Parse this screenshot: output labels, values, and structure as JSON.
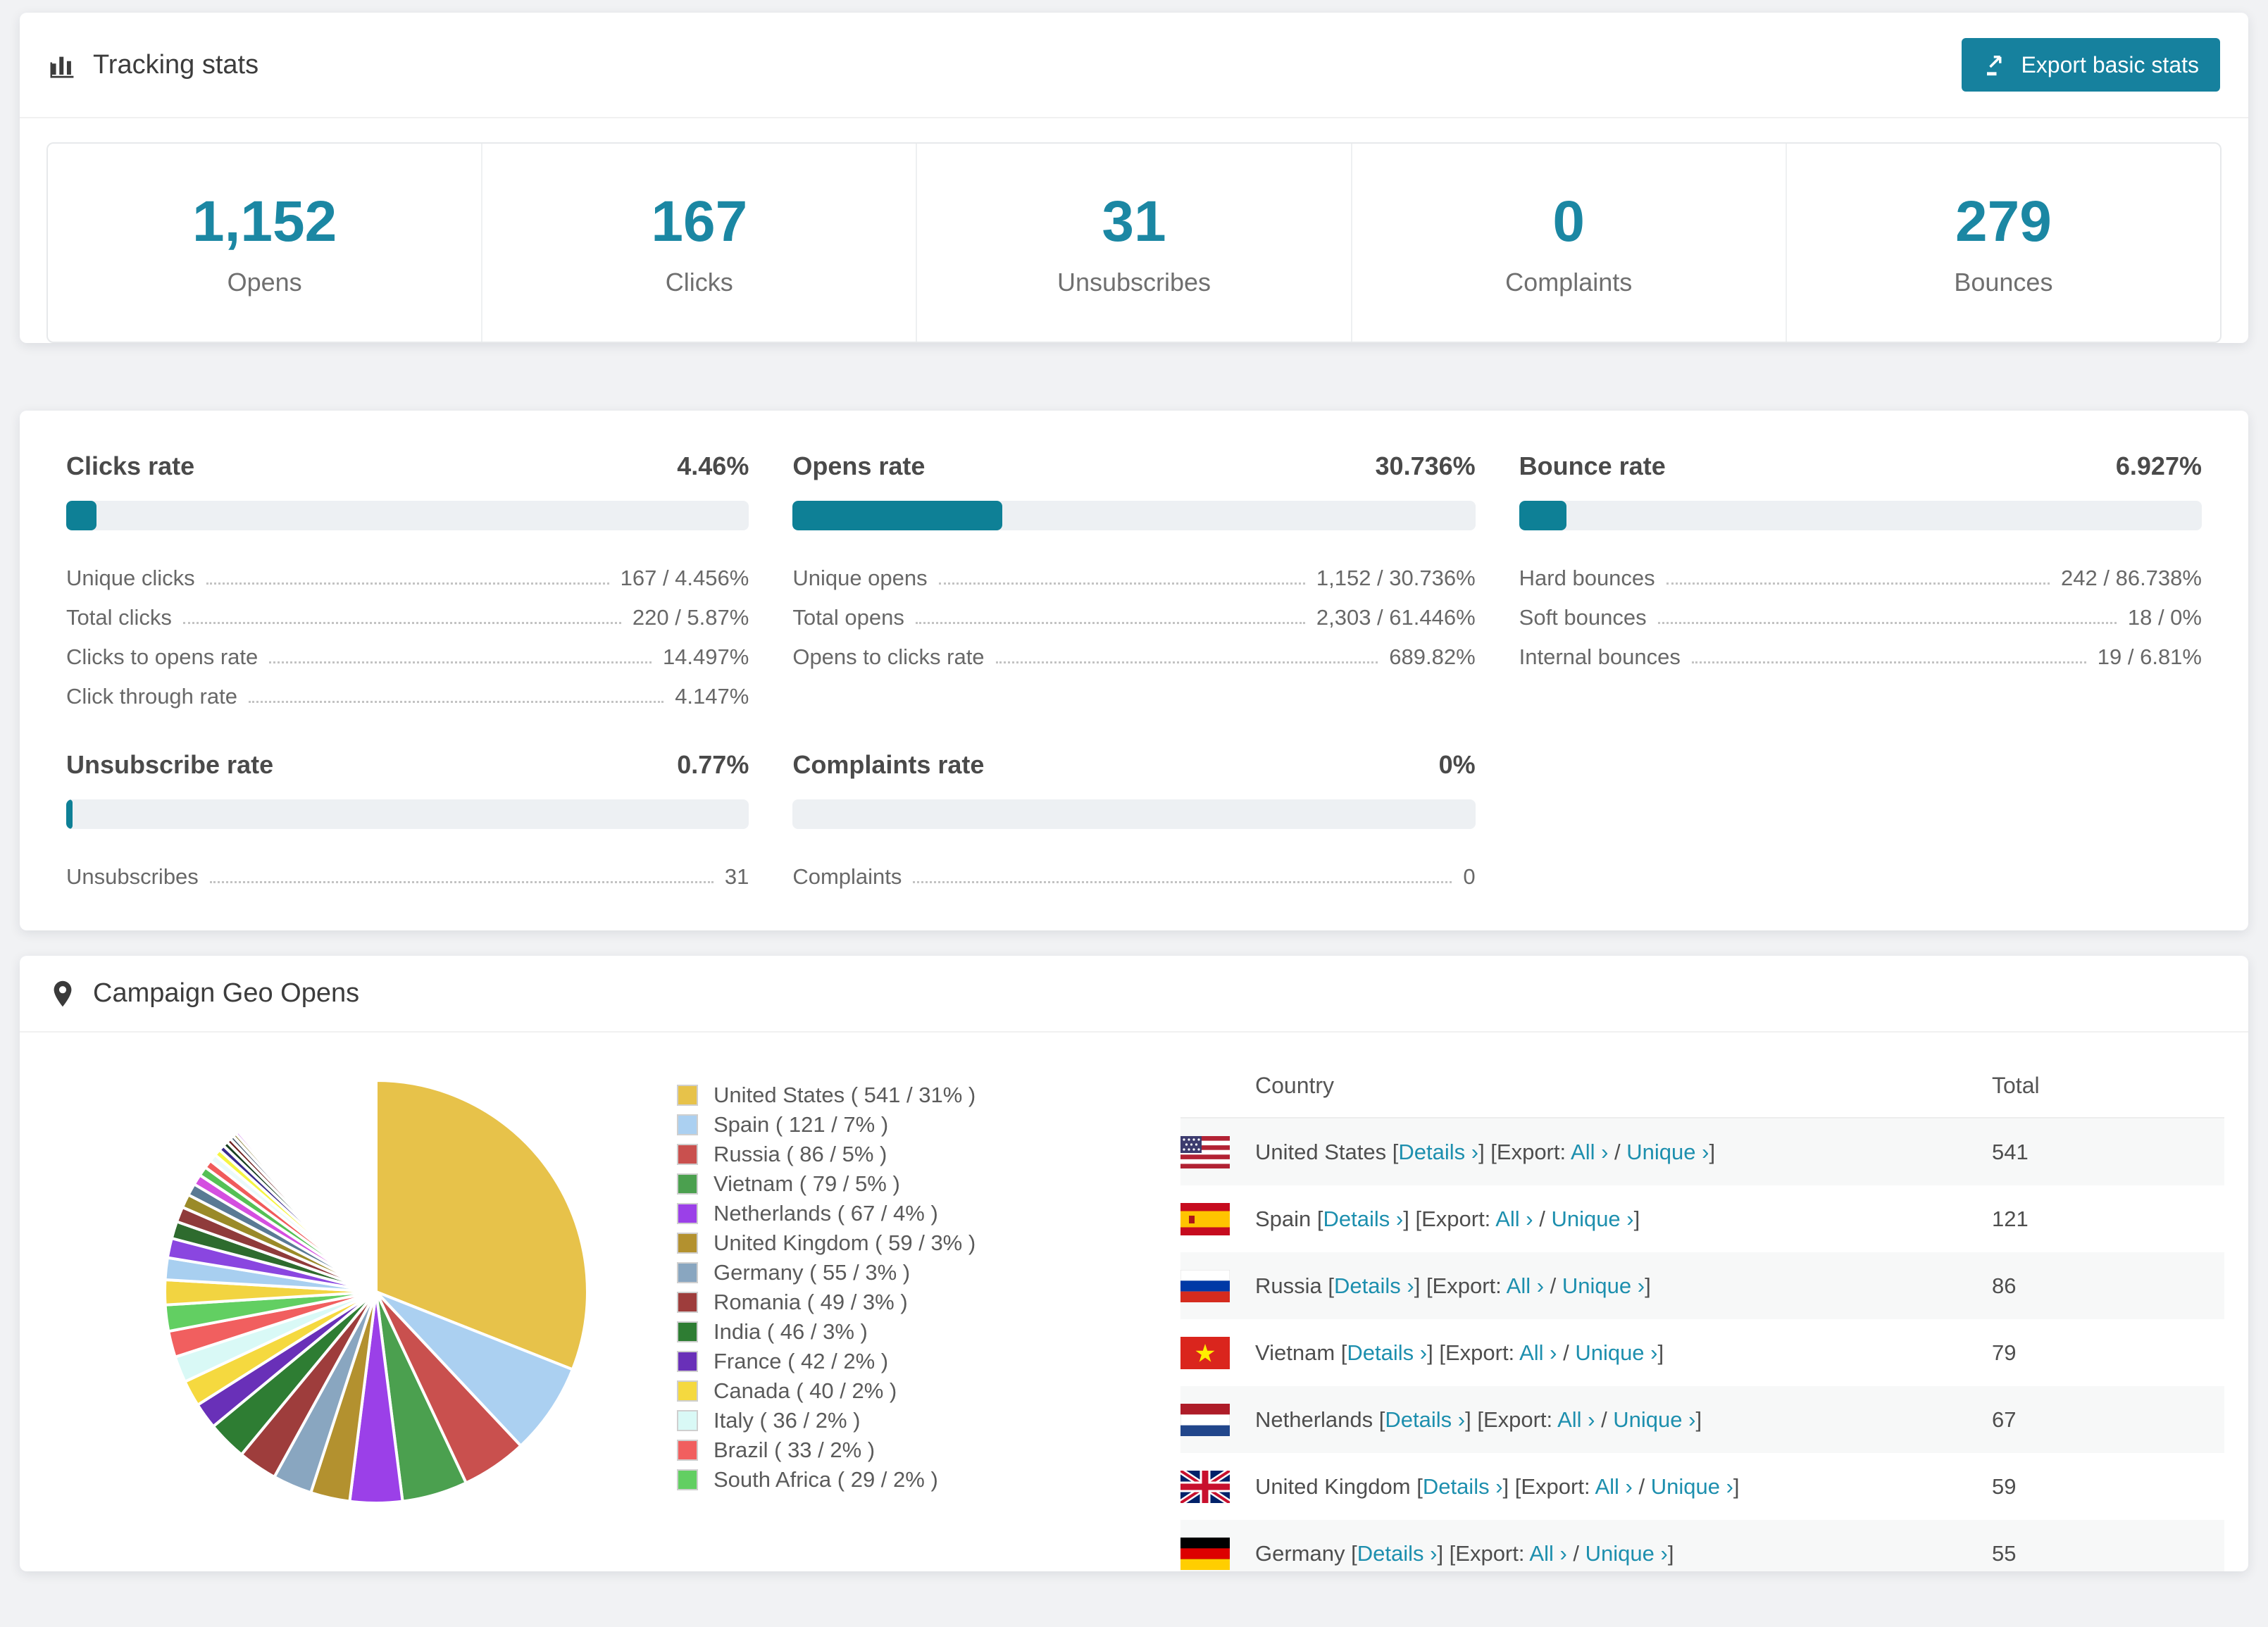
{
  "accent": "#16819e",
  "tracking": {
    "title": "Tracking stats",
    "export_button": "Export basic stats",
    "summary": [
      {
        "value": "1,152",
        "label": "Opens"
      },
      {
        "value": "167",
        "label": "Clicks"
      },
      {
        "value": "31",
        "label": "Unsubscribes"
      },
      {
        "value": "0",
        "label": "Complaints"
      },
      {
        "value": "279",
        "label": "Bounces"
      }
    ]
  },
  "rates": {
    "sections": [
      {
        "title": "Clicks rate",
        "value": "4.46%",
        "bar_pct": 4.46,
        "rows": [
          {
            "label": "Unique clicks",
            "value": "167 / 4.456%"
          },
          {
            "label": "Total clicks",
            "value": "220 / 5.87%"
          },
          {
            "label": "Clicks to opens rate",
            "value": "14.497%"
          },
          {
            "label": "Click through rate",
            "value": "4.147%"
          }
        ]
      },
      {
        "title": "Opens rate",
        "value": "30.736%",
        "bar_pct": 30.736,
        "rows": [
          {
            "label": "Unique opens",
            "value": "1,152 / 30.736%"
          },
          {
            "label": "Total opens",
            "value": "2,303 / 61.446%"
          },
          {
            "label": "Opens to clicks rate",
            "value": "689.82%"
          }
        ]
      },
      {
        "title": "Bounce rate",
        "value": "6.927%",
        "bar_pct": 6.927,
        "rows": [
          {
            "label": "Hard bounces",
            "value": "242 / 86.738%"
          },
          {
            "label": "Soft bounces",
            "value": "18 / 0%"
          },
          {
            "label": "Internal bounces",
            "value": "19 / 6.81%"
          }
        ]
      },
      {
        "title": "Unsubscribe rate",
        "value": "0.77%",
        "bar_pct": 0.77,
        "rows": [
          {
            "label": "Unsubscribes",
            "value": "31"
          }
        ]
      },
      {
        "title": "Complaints rate",
        "value": "0%",
        "bar_pct": 0,
        "rows": [
          {
            "label": "Complaints",
            "value": "0"
          }
        ]
      }
    ]
  },
  "geo": {
    "title": "Campaign Geo Opens",
    "legend": [
      {
        "name": "United States",
        "count": "541",
        "pct": 31,
        "color": "#e7c24a"
      },
      {
        "name": "Spain",
        "count": "121",
        "pct": 7,
        "color": "#abd0f1"
      },
      {
        "name": "Russia",
        "count": "86",
        "pct": 5,
        "color": "#c9504e"
      },
      {
        "name": "Vietnam",
        "count": "79",
        "pct": 5,
        "color": "#4ba04f"
      },
      {
        "name": "Netherlands",
        "count": "67",
        "pct": 4,
        "color": "#9b40e8"
      },
      {
        "name": "United Kingdom",
        "count": "59",
        "pct": 3,
        "color": "#b3912f"
      },
      {
        "name": "Germany",
        "count": "55",
        "pct": 3,
        "color": "#89a6c0"
      },
      {
        "name": "Romania",
        "count": "49",
        "pct": 3,
        "color": "#9e3d3c"
      },
      {
        "name": "India",
        "count": "46",
        "pct": 3,
        "color": "#2e7d33"
      },
      {
        "name": "France",
        "count": "42",
        "pct": 2,
        "color": "#6930b8"
      },
      {
        "name": "Canada",
        "count": "40",
        "pct": 2,
        "color": "#f5d93f"
      },
      {
        "name": "Italy",
        "count": "36",
        "pct": 2,
        "color": "#d9f9f6"
      },
      {
        "name": "Brazil",
        "count": "33",
        "pct": 2,
        "color": "#f15f5f"
      },
      {
        "name": "South Africa",
        "count": "29",
        "pct": 2,
        "color": "#62cf62"
      }
    ],
    "pie_extra_colors": [
      "#f2d441",
      "#a8cff0",
      "#8a46e0",
      "#2e6b2e",
      "#8f3b3b",
      "#9a8a28",
      "#5a7a94",
      "#d44fe0",
      "#55c055",
      "#f05b5b",
      "#eafafa",
      "#f5f542",
      "#3a2a8a",
      "#173f1f",
      "#6e1f1f",
      "#44596b",
      "#7a6b1a",
      "#c24fe8",
      "#66e066",
      "#fc5f5f",
      "#f0ffff",
      "#ffff55",
      "#5533aa",
      "#225522",
      "#882222",
      "#667788",
      "#998822",
      "#dd55ee",
      "#77ee77",
      "#ff7777",
      "#eeffff",
      "#ffff88",
      "#7755cc",
      "#338833",
      "#aa4444",
      "#8899aa",
      "#bbaa33",
      "#dd88ff"
    ],
    "table": {
      "columns": [
        "Country",
        "Total"
      ],
      "bracket_open": "[",
      "bracket_close_export": "] [Export:",
      "slash": "/",
      "bracket_close": "]",
      "links": {
        "details": "Details ›",
        "all": "All ›",
        "unique": "Unique ›"
      },
      "rows": [
        {
          "name": "United States",
          "total": "541",
          "flag": "us"
        },
        {
          "name": "Spain",
          "total": "121",
          "flag": "es"
        },
        {
          "name": "Russia",
          "total": "86",
          "flag": "ru"
        },
        {
          "name": "Vietnam",
          "total": "79",
          "flag": "vn"
        },
        {
          "name": "Netherlands",
          "total": "67",
          "flag": "nl"
        },
        {
          "name": "United Kingdom",
          "total": "59",
          "flag": "gb"
        },
        {
          "name": "Germany",
          "total": "55",
          "flag": "de"
        }
      ]
    }
  },
  "chart_data": {
    "type": "pie",
    "title": "Campaign Geo Opens",
    "series": [
      {
        "name": "United States",
        "value": 541,
        "pct": 31
      },
      {
        "name": "Spain",
        "value": 121,
        "pct": 7
      },
      {
        "name": "Russia",
        "value": 86,
        "pct": 5
      },
      {
        "name": "Vietnam",
        "value": 79,
        "pct": 5
      },
      {
        "name": "Netherlands",
        "value": 67,
        "pct": 4
      },
      {
        "name": "United Kingdom",
        "value": 59,
        "pct": 3
      },
      {
        "name": "Germany",
        "value": 55,
        "pct": 3
      },
      {
        "name": "Romania",
        "value": 49,
        "pct": 3
      },
      {
        "name": "India",
        "value": 46,
        "pct": 3
      },
      {
        "name": "France",
        "value": 42,
        "pct": 2
      },
      {
        "name": "Canada",
        "value": 40,
        "pct": 2
      },
      {
        "name": "Italy",
        "value": 36,
        "pct": 2
      },
      {
        "name": "Brazil",
        "value": 33,
        "pct": 2
      },
      {
        "name": "South Africa",
        "value": 29,
        "pct": 2
      }
    ],
    "other_slices_pct_total": 24,
    "legend_position": "right"
  }
}
